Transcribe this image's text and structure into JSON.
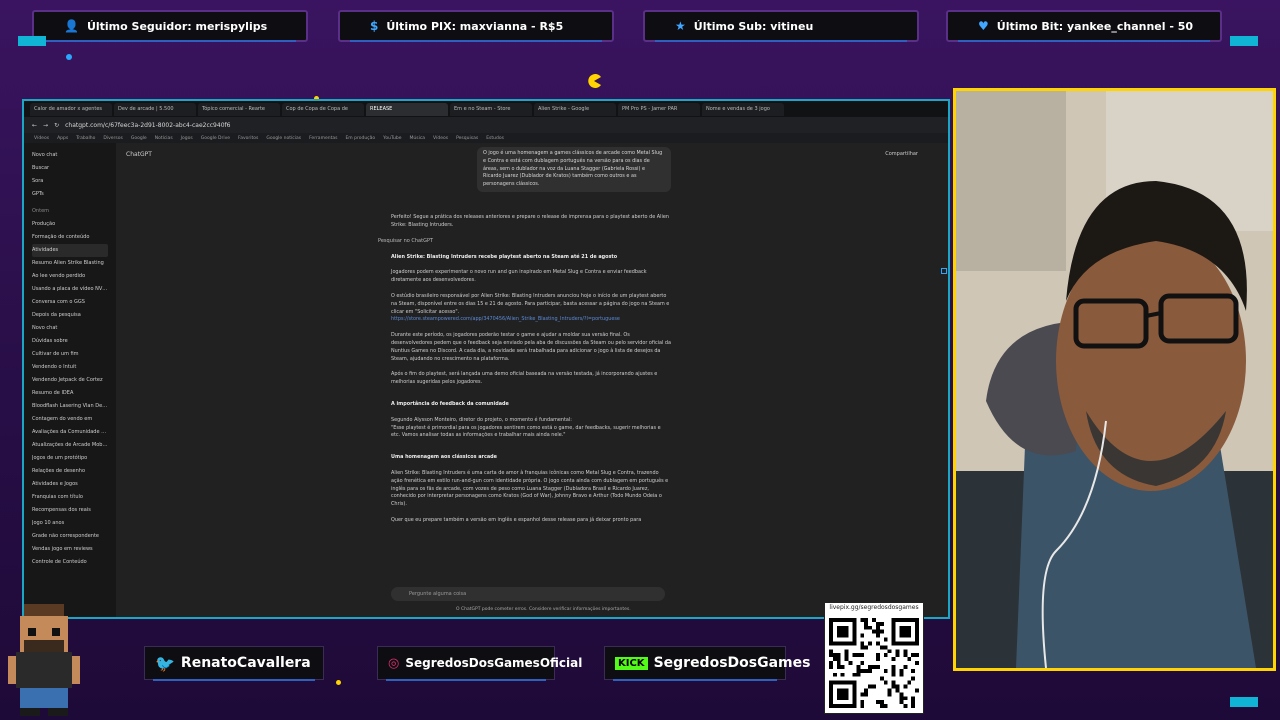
{
  "alerts": {
    "follower": "Último Seguidor: merispylips",
    "pix": "Último PIX: maxvianna - R$5",
    "sub": "Último Sub: vitineu",
    "bit": "Último Bit: yankee_channel - 50"
  },
  "icons": {
    "follower": "user-icon",
    "pix": "dollar-icon",
    "sub": "star-icon",
    "bit": "heart-icon"
  },
  "browser": {
    "tabs": [
      "Calor de amador x agentes",
      "Dev de arcade | 5.500",
      "Tópico comercial - Rearte",
      "Cop de Copa de Copa de",
      "RELEASE",
      "Em e no Steam - Store",
      "Alien Strike - Google",
      "PM Pro PS - Jamer PAR",
      "Nome e vendas de 3 jogo"
    ],
    "url": "chatgpt.com/c/67feec3a-2d91-8002-abc4-cae2cc940f6",
    "bookmarks": [
      "Vídeos",
      "Apps",
      "Trabalho",
      "Diversos",
      "Google",
      "Notícias",
      "Jogos",
      "Google Drive",
      "Favoritos",
      "Google notícias",
      "Ferramentas",
      "Em produção",
      "YouTube",
      "Música",
      "Vídeos",
      "Pesquisas",
      "Estudos"
    ]
  },
  "sidebar": {
    "top": [
      "Novo chat",
      "Buscar",
      "Sora",
      "GPTs"
    ],
    "section": "Ontem",
    "items": [
      "Produção",
      "Formação de conteúdo",
      "Atividades",
      "Resumo Alien Strike Blasting",
      "Ao lee vendo perdido",
      "Usando a placa de vídeo NVIDIA",
      "Conversa com o GGS",
      "Depois da pesquisa",
      "Novo chat",
      "Dúvidas sobre",
      "Cultivar de um fim",
      "Vendendo o Intuit",
      "Vendendo Jetpack de Cortez",
      "Resumo de IDEA",
      "Bloodflash Lasering Vlan Desert",
      "Contagem do vendo em",
      "Avaliações da Comunidade Steam",
      "Atualizações de Arcade Mobile",
      "Jogos de um protótipo",
      "Relações de desenho",
      "Atividades e Jogos",
      "Franquias com título",
      "Recompensas dos reais",
      "Jogo 10 anos",
      "Grade não correspondente",
      "Vendas jogo em reviews",
      "Controle de Conteúdo"
    ]
  },
  "main": {
    "model": "ChatGPT",
    "share": "Compartilhar",
    "bubble": "O jogo é uma homenagem a games clássicos de arcade como Metal Slug e Contra e está com dublagem português na versão para os dias de áreas, sem o dublador na voz da Luana Stagger (Gabriela Rossi) e Ricardo Juarez (Dublador de Kratos) também como outros e as personagens clássicos.",
    "intro": "Perfeito! Segue a prática dos releases anteriores e prepare o release de imprensa para o playtest aberto de Alien Strike: Blasting Intruders.",
    "searching": "Pesquisar no ChatGPT",
    "headline": "Alien Strike: Blasting Intruders recebe playtest aberto na Steam até 21 de agosto",
    "lede": "Jogadores podem experimentar o novo run and gun inspirado em Metal Slug e Contra e enviar feedback diretamente aos desenvolvedores.",
    "p1": "O estúdio brasileiro responsável por Alien Strike: Blasting Intruders anunciou hoje o início de um playtest aberto na Steam, disponível entre os dias 15 e 21 de agosto. Para participar, basta acessar a página do jogo na Steam e clicar em \"Solicitar acesso\".",
    "link": "https://store.steampowered.com/app/3470456/Alien_Strike_Blasting_Intruders/?l=portuguese",
    "p2": "Durante este período, os jogadores poderão testar o game e ajudar a moldar sua versão final. Os desenvolvedores pedem que o feedback seja enviado pela aba de discussões da Steam ou pelo servidor oficial da Nuntius Games no Discord. A cada dia, a novidade será trabalhada para adicionar o jogo à lista de desejos da Steam, ajudando no crescimento na plataforma.",
    "p3": "Após o fim do playtest, será lançada uma demo oficial baseada na versão testada, já incorporando ajustes e melhorias sugeridas pelos jogadores.",
    "h1": "A importância do feedback da comunidade",
    "p4": "Segundo Alysson Monteiro, diretor do projeto, o momento é fundamental:",
    "quote": "\"Esse playtest é primordial para os jogadores sentirem como está o game, dar feedbacks, sugerir melhorias e etc. Vamos analisar todas as informações e trabalhar mais ainda nele.\"",
    "h2": "Uma homenagem aos clássicos arcade",
    "p5": "Alien Strike: Blasting Intruders é uma carta de amor à franquias icônicas como Metal Slug e Contra, trazendo ação frenética em estilo run-and-gun com identidade própria. O jogo conta ainda com dublagem em português e inglês para os fãs de arcade, com vozes de peso como Luana Stagger (Dubladora Brasil e Ricardo Juarez, conhecido por interpretar personagens como Kratos (God of War), Johnny Bravo e Arthur (Todo Mundo Odeia o Chris).",
    "p6": "Quer que eu prepare também a versão em inglês e espanhol desse release para já deixar pronto para",
    "composer": "Pergunte alguma coisa",
    "disclaimer": "O ChatGPT pode cometer erros. Considere verificar informações importantes."
  },
  "social": {
    "twitter": "RenatoCavallera",
    "instagram": "SegredosDosGamesOficial",
    "kick_logo": "KICK",
    "kick": "SegredosDosGames",
    "qr_url": "livepix.gg/segredosdosgames"
  },
  "colors": {
    "accent_yellow": "#ffd400",
    "accent_blue": "#2aa8ff",
    "bg_purple": "#2a0f4a",
    "kick_green": "#53fc18"
  }
}
